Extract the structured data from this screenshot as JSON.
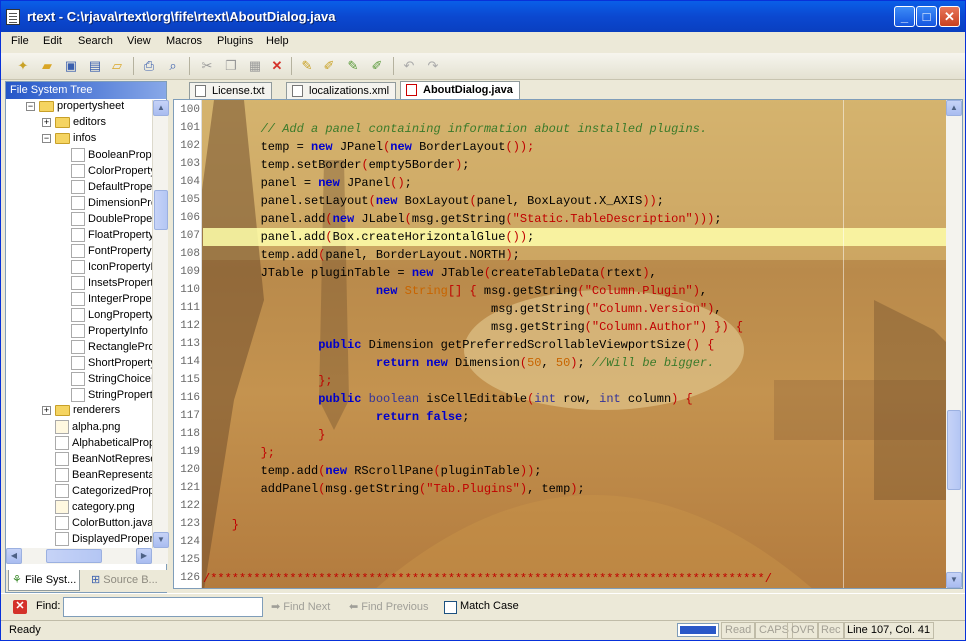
{
  "window": {
    "title": "rtext - C:\\rjava\\rtext\\org\\fife\\rtext\\AboutDialog.java",
    "min": "_",
    "max": "□",
    "close": "✕"
  },
  "menu": [
    "File",
    "Edit",
    "Search",
    "View",
    "Macros",
    "Plugins",
    "Help"
  ],
  "left_panel": {
    "header": "File System Tree",
    "tree": [
      {
        "depth": 1,
        "type": "folder",
        "expander": "−",
        "label": "propertysheet"
      },
      {
        "depth": 2,
        "type": "folder",
        "expander": "+",
        "label": "editors"
      },
      {
        "depth": 2,
        "type": "folder",
        "expander": "−",
        "label": "infos"
      },
      {
        "depth": 3,
        "type": "java",
        "label": "BooleanPropertyInfo"
      },
      {
        "depth": 3,
        "type": "java",
        "label": "ColorPropertyInfo"
      },
      {
        "depth": 3,
        "type": "java",
        "label": "DefaultPropertyInfo"
      },
      {
        "depth": 3,
        "type": "java",
        "label": "DimensionPropertyInfo"
      },
      {
        "depth": 3,
        "type": "java",
        "label": "DoublePropertyInfo"
      },
      {
        "depth": 3,
        "type": "java",
        "label": "FloatPropertyInfo"
      },
      {
        "depth": 3,
        "type": "java",
        "label": "FontPropertyInfo"
      },
      {
        "depth": 3,
        "type": "java",
        "label": "IconPropertyInfo"
      },
      {
        "depth": 3,
        "type": "java",
        "label": "InsetsPropertyInfo"
      },
      {
        "depth": 3,
        "type": "java",
        "label": "IntegerPropertyInfo"
      },
      {
        "depth": 3,
        "type": "java",
        "label": "LongPropertyInfo"
      },
      {
        "depth": 3,
        "type": "java",
        "label": "PropertyInfo"
      },
      {
        "depth": 3,
        "type": "java",
        "label": "RectanglePropertyInfo"
      },
      {
        "depth": 3,
        "type": "java",
        "label": "ShortPropertyInfo"
      },
      {
        "depth": 3,
        "type": "java",
        "label": "StringChoicePropertyInfo"
      },
      {
        "depth": 3,
        "type": "java",
        "label": "StringPropertyInfo"
      },
      {
        "depth": 2,
        "type": "folder",
        "expander": "+",
        "label": "renderers"
      },
      {
        "depth": 2,
        "type": "png",
        "label": "alpha.png"
      },
      {
        "depth": 2,
        "type": "java",
        "label": "AlphabeticalPropertyComparator"
      },
      {
        "depth": 2,
        "type": "java",
        "label": "BeanNotRepresentableException"
      },
      {
        "depth": 2,
        "type": "java",
        "label": "BeanRepresentation"
      },
      {
        "depth": 2,
        "type": "java",
        "label": "CategorizedPropertySheet"
      },
      {
        "depth": 2,
        "type": "png",
        "label": "category.png"
      },
      {
        "depth": 2,
        "type": "java",
        "label": "ColorButton.java"
      },
      {
        "depth": 2,
        "type": "java",
        "label": "DisplayedPropertyInfo"
      }
    ],
    "tabs": [
      {
        "label": "File Syst..."
      },
      {
        "label": "Source B..."
      }
    ]
  },
  "editor_tabs": [
    "License.txt",
    "localizations.xml",
    "AboutDialog.java"
  ],
  "code": {
    "first_line": 100,
    "current_line": 107,
    "lines": [
      [],
      [
        [
          "cm",
          "        // Add a panel containing information about installed plugins."
        ]
      ],
      [
        [
          "",
          "        temp = "
        ],
        [
          "kw",
          "new"
        ],
        [
          "",
          " JPanel"
        ],
        [
          "str",
          "("
        ],
        [
          "kw",
          "new"
        ],
        [
          "",
          " BorderLayout"
        ],
        [
          "str",
          "());"
        ]
      ],
      [
        [
          "",
          "        temp.setBorder"
        ],
        [
          "str",
          "("
        ],
        [
          "",
          "empty5Border"
        ],
        [
          "str",
          ")"
        ],
        [
          "",
          ";"
        ]
      ],
      [
        [
          "",
          "        panel = "
        ],
        [
          "kw",
          "new"
        ],
        [
          "",
          " JPanel"
        ],
        [
          "str",
          "()"
        ],
        [
          "",
          ";"
        ]
      ],
      [
        [
          "",
          "        panel.setLayout"
        ],
        [
          "str",
          "("
        ],
        [
          "kw",
          "new"
        ],
        [
          "",
          " BoxLayout"
        ],
        [
          "str",
          "("
        ],
        [
          "",
          "panel, BoxLayout.X_AXIS"
        ],
        [
          "str",
          "))"
        ],
        [
          "",
          ";"
        ]
      ],
      [
        [
          "",
          "        panel.add"
        ],
        [
          "str",
          "("
        ],
        [
          "kw",
          "new"
        ],
        [
          "",
          " JLabel"
        ],
        [
          "str",
          "("
        ],
        [
          "",
          "msg.getString"
        ],
        [
          "str",
          "(\"Static.TableDescription\")))"
        ],
        [
          "",
          ";"
        ]
      ],
      [
        [
          "",
          "        panel.add"
        ],
        [
          "str",
          "("
        ],
        [
          "",
          "Box.createHorizontalGlue"
        ],
        [
          "str",
          "())"
        ],
        [
          "",
          ";"
        ]
      ],
      [
        [
          "",
          "        temp.add"
        ],
        [
          "str",
          "("
        ],
        [
          "",
          "panel, BorderLayout.NORTH"
        ],
        [
          "str",
          ")"
        ],
        [
          "",
          ";"
        ]
      ],
      [
        [
          "",
          "        JTable pluginTable = "
        ],
        [
          "kw",
          "new"
        ],
        [
          "",
          " JTable"
        ],
        [
          "str",
          "("
        ],
        [
          "",
          "createTableData"
        ],
        [
          "str",
          "("
        ],
        [
          "",
          "rtext"
        ],
        [
          "str",
          ")"
        ],
        [
          "",
          ","
        ]
      ],
      [
        [
          "",
          "                        "
        ],
        [
          "kw",
          "new"
        ],
        [
          "",
          " "
        ],
        [
          "num",
          "String"
        ],
        [
          "str",
          "[] { "
        ],
        [
          "",
          "msg.getString"
        ],
        [
          "str",
          "(\"Column.Plugin\")"
        ],
        [
          "",
          ","
        ]
      ],
      [
        [
          "",
          "                                        msg.getString"
        ],
        [
          "str",
          "(\"Column.Version\")"
        ],
        [
          "",
          ","
        ]
      ],
      [
        [
          "",
          "                                        msg.getString"
        ],
        [
          "str",
          "(\"Column.Author\") }) {"
        ]
      ],
      [
        [
          "",
          "                "
        ],
        [
          "kw",
          "public"
        ],
        [
          "",
          " Dimension getPreferredScrollableViewportSize"
        ],
        [
          "str",
          "() {"
        ]
      ],
      [
        [
          "",
          "                        "
        ],
        [
          "kw",
          "return"
        ],
        [
          "",
          " "
        ],
        [
          "kw",
          "new"
        ],
        [
          "",
          " Dimension"
        ],
        [
          "str",
          "("
        ],
        [
          "num",
          "50"
        ],
        [
          "",
          ", "
        ],
        [
          "num",
          "50"
        ],
        [
          "str",
          ")"
        ],
        [
          "",
          "; "
        ],
        [
          "cm",
          "//Will be bigger."
        ]
      ],
      [
        [
          "str",
          "                };"
        ]
      ],
      [
        [
          "",
          "                "
        ],
        [
          "kw",
          "public"
        ],
        [
          "",
          " "
        ],
        [
          "ty",
          "boolean"
        ],
        [
          "",
          " isCellEditable"
        ],
        [
          "str",
          "("
        ],
        [
          "ty",
          "int"
        ],
        [
          "",
          " row, "
        ],
        [
          "ty",
          "int"
        ],
        [
          "",
          " column"
        ],
        [
          "str",
          ") {"
        ]
      ],
      [
        [
          "",
          "                        "
        ],
        [
          "kw",
          "return"
        ],
        [
          "",
          " "
        ],
        [
          "kw",
          "false"
        ],
        [
          "",
          ";"
        ]
      ],
      [
        [
          "str",
          "                }"
        ]
      ],
      [
        [
          "str",
          "        };"
        ]
      ],
      [
        [
          "",
          "        temp.add"
        ],
        [
          "str",
          "("
        ],
        [
          "kw",
          "new"
        ],
        [
          "",
          " RScrollPane"
        ],
        [
          "str",
          "("
        ],
        [
          "",
          "pluginTable"
        ],
        [
          "str",
          "))"
        ],
        [
          "",
          ";"
        ]
      ],
      [
        [
          "",
          "        addPanel"
        ],
        [
          "str",
          "("
        ],
        [
          "",
          "msg.getString"
        ],
        [
          "str",
          "(\"Tab.Plugins\")"
        ],
        [
          "",
          ", temp"
        ],
        [
          "str",
          ")"
        ],
        [
          "",
          ";"
        ]
      ],
      [],
      [
        [
          "str",
          "    }"
        ]
      ],
      [],
      [],
      [
        [
          "str",
          "/*****************************************************************************/"
        ]
      ]
    ]
  },
  "find_bar": {
    "label": "Find:",
    "value": "",
    "find_next": "Find Next",
    "find_previous": "Find Previous",
    "match_case": "Match Case",
    "match_case_checked": false
  },
  "status": {
    "text": "Ready",
    "progress_fraction": 0.95,
    "indicators": [
      "Read",
      "CAPS",
      "OVR",
      "Rec"
    ],
    "position": "Line 107, Col. 41"
  },
  "colors": {
    "title_bar": "#0a5fe8",
    "current_line": "#ffffaa",
    "keyword": "#0000cc",
    "string": "#c00000",
    "comment": "#3a7a2a"
  }
}
